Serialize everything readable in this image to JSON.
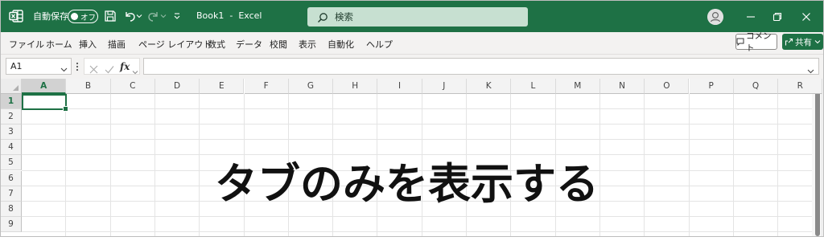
{
  "titlebar": {
    "app_icon": "excel-logo-icon",
    "autosave_label": "自動保存",
    "autosave_state": "オフ",
    "document_name": "Book1  -  Excel",
    "search_placeholder": "検索",
    "colors": {
      "brand": "#1e7145",
      "search_bg": "#c7e0d1"
    }
  },
  "ribbon": {
    "tabs": [
      "ファイル",
      "ホーム",
      "挿入",
      "描画",
      "ページ レイアウト",
      "数式",
      "データ",
      "校閲",
      "表示",
      "自動化",
      "ヘルプ"
    ],
    "comment_label": "コメント",
    "share_label": "共有"
  },
  "formula_bar": {
    "name_box_value": "A1",
    "fx_label": "fx",
    "formula_value": ""
  },
  "sheet": {
    "columns": [
      "A",
      "B",
      "C",
      "D",
      "E",
      "F",
      "G",
      "H",
      "I",
      "J",
      "K",
      "L",
      "M",
      "N",
      "O",
      "P",
      "Q",
      "R"
    ],
    "rows": [
      "1",
      "2",
      "3",
      "4",
      "5",
      "6",
      "7",
      "8",
      "9"
    ],
    "selected_cell": "A1"
  },
  "overlay": {
    "caption": "タブのみを表示する"
  }
}
